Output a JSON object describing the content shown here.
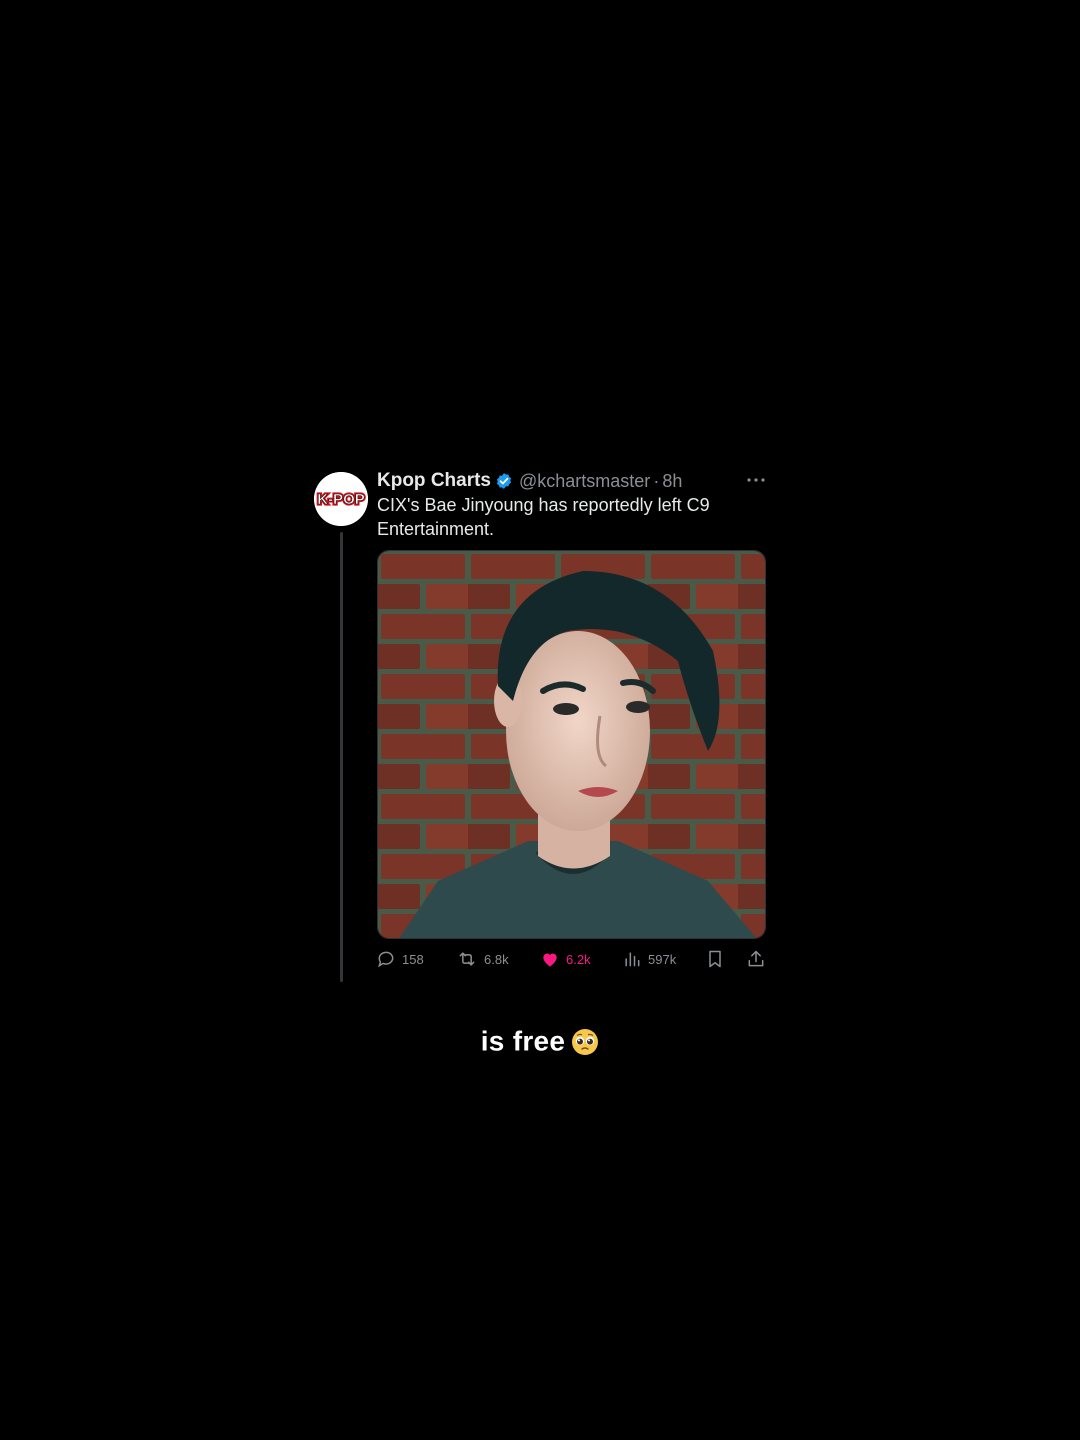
{
  "tweet": {
    "avatar_logo": "K-POP",
    "display_name": "Kpop Charts",
    "verified": true,
    "handle": "@kchartsmaster",
    "separator": "·",
    "time": "8h",
    "text": "CIX's Bae Jinyoung has reportedly left C9 Entertainment.",
    "actions": {
      "replies": "158",
      "reposts": "6.8k",
      "likes": "6.2k",
      "views": "597k"
    },
    "colors": {
      "like_active": "#f91880",
      "verified": "#1d9bf0",
      "muted": "#8b8f94"
    }
  },
  "caption": {
    "text": "is free",
    "emoji": "pleading-face-emoji"
  }
}
